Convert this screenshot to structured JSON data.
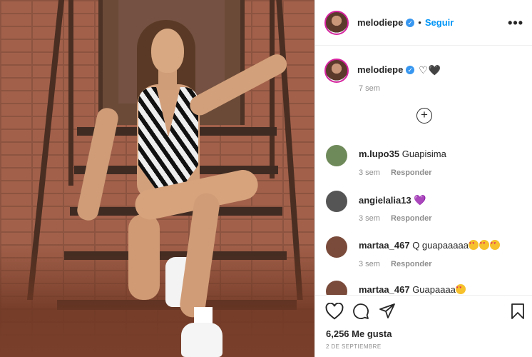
{
  "header": {
    "username": "melodiepe",
    "verified_mark": "✓",
    "separator": "•",
    "follow_label": "Seguir",
    "more_label": "•••"
  },
  "caption": {
    "username": "melodiepe",
    "verified_mark": "✓",
    "text": "♡🖤",
    "time": "7 sem"
  },
  "load_more_label": "+",
  "comments": [
    {
      "username": "m.lupo35",
      "text": "Guapisima",
      "time": "3 sem",
      "reply": "Responder",
      "avatar_color": "#6f8a5a"
    },
    {
      "username": "angielalia13",
      "text": "💜",
      "time": "3 sem",
      "reply": "Responder",
      "avatar_color": "#555555"
    },
    {
      "username": "martaa_467",
      "text": "Q guapaaaaa",
      "emoji_count": 3,
      "time": "3 sem",
      "reply": "Responder",
      "avatar_color": "#7a4a3a"
    },
    {
      "username": "martaa_467",
      "text": "Guapaaaa",
      "emoji_count": 1,
      "time": "",
      "reply": "",
      "avatar_color": "#7a4a3a"
    }
  ],
  "actions": {
    "like_icon": "heart-outline-icon",
    "comment_icon": "comment-icon",
    "share_icon": "paper-plane-icon",
    "save_icon": "bookmark-icon",
    "likes_text": "6,256 Me gusta",
    "date_text": "2 DE SEPTIEMBRE"
  },
  "colors": {
    "link_blue": "#0095f6",
    "verified_blue": "#3897f0",
    "muted_text": "#8e8e8e"
  }
}
